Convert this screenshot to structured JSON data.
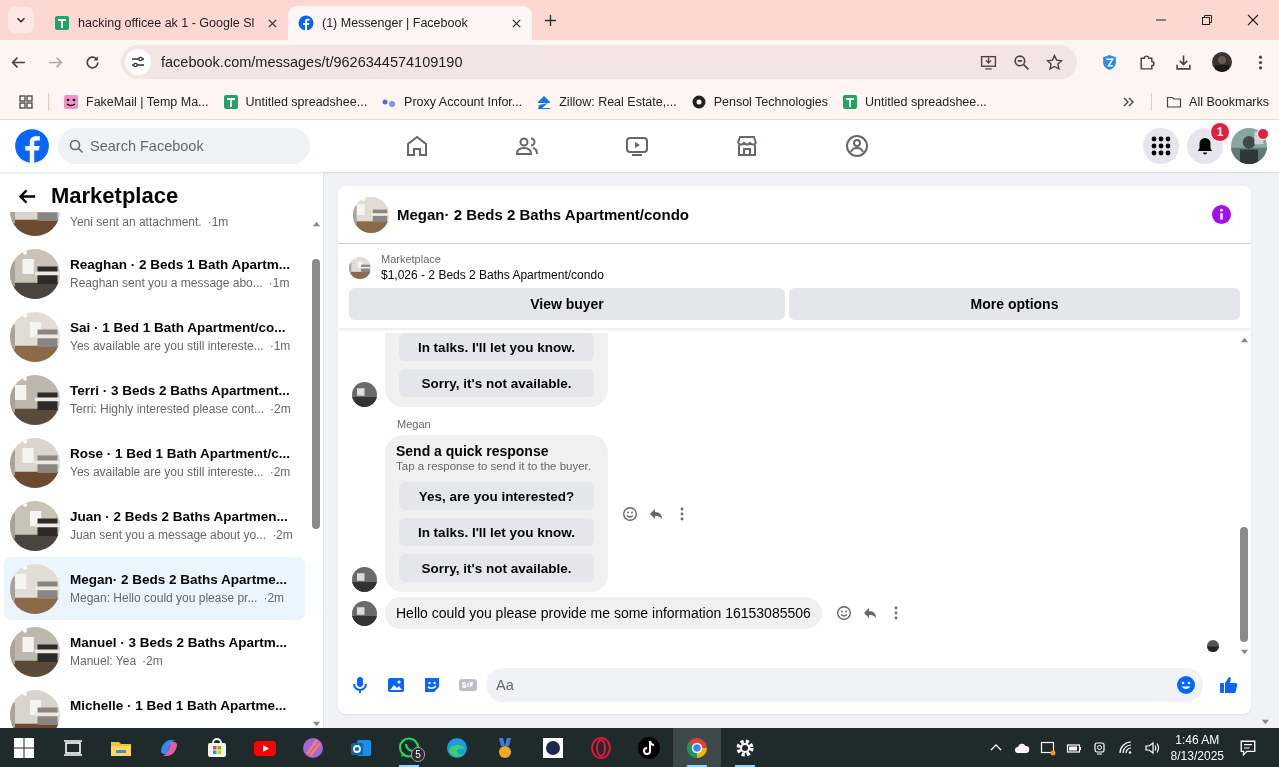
{
  "browser": {
    "tabs": [
      {
        "title": "hacking officee ak 1 - Google Sl",
        "kind": "sheets",
        "selected": false
      },
      {
        "title": "(1) Messenger | Facebook",
        "kind": "facebook",
        "selected": true
      }
    ],
    "url": "facebook.com/messages/t/9626344574109190",
    "bookmarks": [
      {
        "label": "FakeMail | Temp Ma...",
        "kind": "fakemail"
      },
      {
        "label": "Untitled spreadshee...",
        "kind": "sheets"
      },
      {
        "label": "Proxy Account Infor...",
        "kind": "proxy"
      },
      {
        "label": "Zillow: Real Estate,...",
        "kind": "zillow"
      },
      {
        "label": "Pensol Technologies",
        "kind": "pensol"
      },
      {
        "label": "Untitled spreadshee...",
        "kind": "sheets"
      }
    ],
    "all_bookmarks": "All Bookmarks"
  },
  "facebook": {
    "search": {
      "placeholder": "Search Facebook"
    },
    "notification_count": "1"
  },
  "sidebar": {
    "title": "Marketplace",
    "conversations": [
      {
        "preview": "Yeni sent an attachment.",
        "time": "·1m",
        "selected": false
      },
      {
        "title": "Reaghan · 2 Beds 1 Bath Apartm...",
        "preview": "Reaghan sent you a message abo...",
        "time": "·1m",
        "selected": false
      },
      {
        "title": "Sai · 1 Bed 1 Bath Apartment/co...",
        "preview": "Yes available are you still intereste...",
        "time": "·1m",
        "selected": false
      },
      {
        "title": "Terri · 3 Beds 2 Baths Apartment...",
        "preview": "Terri: Highly interested please cont...",
        "time": "·2m",
        "selected": false
      },
      {
        "title": "Rose · 1 Bed 1 Bath Apartment/c...",
        "preview": "Yes available are you still intereste...",
        "time": "·2m",
        "selected": false
      },
      {
        "title": "Juan · 2 Beds 2 Baths Apartmen...",
        "preview": "Juan sent you a message about yo...",
        "time": "·2m",
        "selected": false
      },
      {
        "title": "Megan· 2 Beds 2 Baths Apartme...",
        "preview": "Megan: Hello could you please pr...",
        "time": "·2m",
        "selected": true
      },
      {
        "title": "Manuel · 3 Beds 2 Baths Apartm...",
        "preview": "Manuel: Yea",
        "time": "·2m",
        "selected": false
      },
      {
        "title": "Michelle · 1 Bed 1 Bath Apartme...",
        "selected": false
      }
    ]
  },
  "chat": {
    "title": "Megan· 2 Beds 2 Baths Apartment/condo",
    "listing": {
      "label": "Marketplace",
      "text": "$1,026 - 2 Beds 2 Baths Apartment/condo"
    },
    "buttons": [
      "View buyer",
      "More options"
    ],
    "messages": [
      {
        "kind": "quick_reply",
        "options": [
          "In talks. I'll let you know.",
          "Sorry, it's not available."
        ]
      },
      {
        "kind": "sender",
        "name": "Megan"
      },
      {
        "kind": "quick_reply",
        "title": "Send a quick response",
        "subtitle": "Tap a response to send it to the buyer.",
        "options": [
          "Yes, are you interested?",
          "In talks. I'll let you know.",
          "Sorry, it's not available."
        ],
        "actions": true
      },
      {
        "kind": "text",
        "text": "Hello could you please provide me some information 16153085506",
        "actions": true
      }
    ],
    "composer": {
      "placeholder": "Aa"
    }
  },
  "taskbar": {
    "apps": [
      {
        "kind": "taskview",
        "running": false,
        "selected": false
      },
      {
        "kind": "explorer",
        "running": false,
        "selected": false
      },
      {
        "kind": "copilot",
        "running": false,
        "selected": false
      },
      {
        "kind": "store",
        "running": false,
        "selected": false
      },
      {
        "kind": "youtube",
        "running": false,
        "selected": false
      },
      {
        "kind": "ball",
        "running": false,
        "selected": false
      },
      {
        "kind": "outlook",
        "running": false,
        "selected": false
      },
      {
        "kind": "whatsapp",
        "running": true,
        "selected": false,
        "badge": "5"
      },
      {
        "kind": "edge",
        "running": false,
        "selected": false
      },
      {
        "kind": "medal",
        "running": false,
        "selected": false
      },
      {
        "kind": "seal",
        "running": false,
        "selected": false
      },
      {
        "kind": "opera",
        "running": false,
        "selected": false
      },
      {
        "kind": "tiktok",
        "running": false,
        "selected": false
      },
      {
        "kind": "chrome",
        "running": true,
        "selected": true
      },
      {
        "kind": "settings",
        "running": true,
        "selected": false
      }
    ],
    "time": "1:46 AM",
    "date": "8/13/2025"
  }
}
